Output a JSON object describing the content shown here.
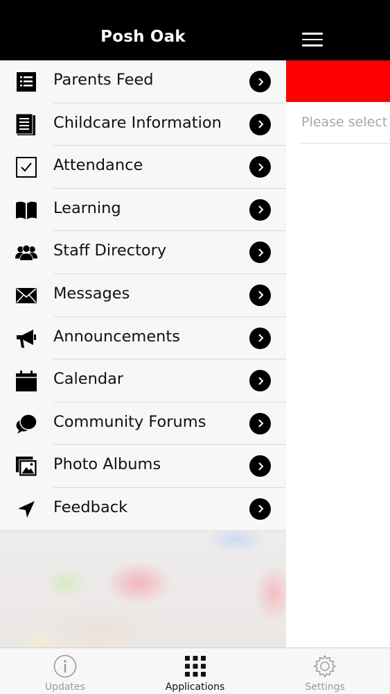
{
  "header": {
    "title": "Posh Oak"
  },
  "menu": {
    "items": [
      {
        "label": "Parents Feed",
        "icon": "list-icon"
      },
      {
        "label": "Childcare Information",
        "icon": "document-icon"
      },
      {
        "label": "Attendance",
        "icon": "checkbox-icon"
      },
      {
        "label": "Learning",
        "icon": "book-icon"
      },
      {
        "label": "Staff Directory",
        "icon": "people-icon"
      },
      {
        "label": "Messages",
        "icon": "envelope-icon"
      },
      {
        "label": "Announcements",
        "icon": "megaphone-icon"
      },
      {
        "label": "Calendar",
        "icon": "calendar-icon"
      },
      {
        "label": "Community Forums",
        "icon": "chat-bubbles-icon"
      },
      {
        "label": "Photo Albums",
        "icon": "photos-icon"
      },
      {
        "label": "Feedback",
        "icon": "paper-plane-icon"
      }
    ]
  },
  "content": {
    "hint": "Please select y",
    "banner_color": "#ff0000"
  },
  "tabbar": {
    "tabs": [
      {
        "label": "Updates",
        "icon": "info-icon",
        "active": false
      },
      {
        "label": "Applications",
        "icon": "grid-icon",
        "active": true
      },
      {
        "label": "Settings",
        "icon": "gear-icon",
        "active": false
      }
    ]
  }
}
